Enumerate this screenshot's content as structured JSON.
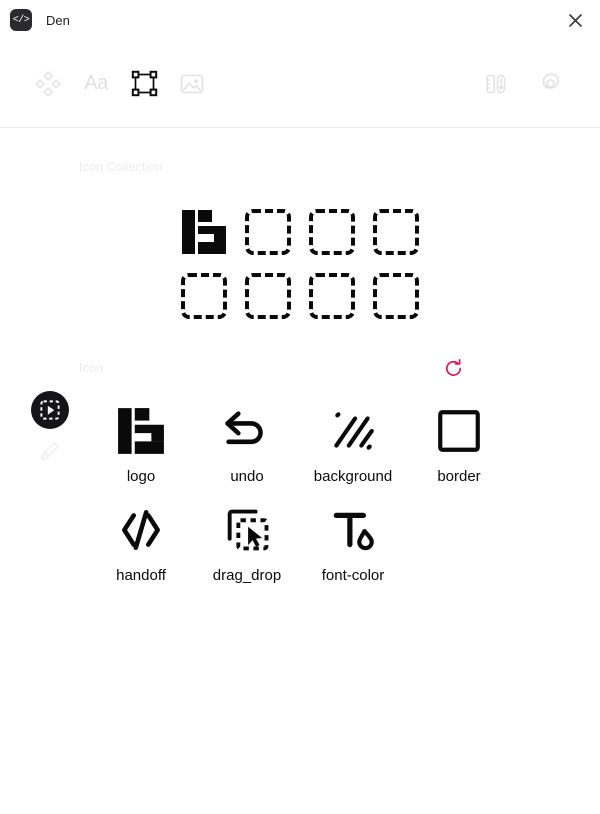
{
  "window": {
    "app_name": "Den",
    "logo_glyph": "</>",
    "logo_icon": "code-brackets-icon",
    "close_icon": "close-icon"
  },
  "toolbar": {
    "left_tools": [
      {
        "name": "shapes-tool",
        "icon": "four-diamonds-icon",
        "label": "",
        "active": false
      },
      {
        "name": "text-tool",
        "icon": "text-aa-icon",
        "label": "Aa",
        "active": false
      },
      {
        "name": "frame-tool",
        "icon": "selection-frame-icon",
        "label": "",
        "active": true
      },
      {
        "name": "image-tool",
        "icon": "image-icon",
        "label": "",
        "active": false
      }
    ],
    "right_tools": [
      {
        "name": "measure-tool",
        "icon": "ruler-icon"
      },
      {
        "name": "settings",
        "icon": "gear-icon"
      }
    ]
  },
  "collection": {
    "label": "Icon Collection",
    "cells": [
      {
        "type": "logo",
        "name": "collection-logo"
      },
      {
        "type": "placeholder",
        "name": "collection-placeholder"
      },
      {
        "type": "placeholder",
        "name": "collection-placeholder"
      },
      {
        "type": "placeholder",
        "name": "collection-placeholder"
      },
      {
        "type": "placeholder",
        "name": "collection-placeholder"
      },
      {
        "type": "placeholder",
        "name": "collection-placeholder"
      },
      {
        "type": "placeholder",
        "name": "collection-placeholder"
      },
      {
        "type": "placeholder",
        "name": "collection-placeholder"
      }
    ]
  },
  "icons_section": {
    "label": "Icon",
    "refresh_icon": "refresh-icon",
    "refresh_color": "#e0115f",
    "items": [
      {
        "label": "logo",
        "icon": "logo-icon"
      },
      {
        "label": "undo",
        "icon": "undo-arrow-icon"
      },
      {
        "label": "background",
        "icon": "diagonal-stripes-icon"
      },
      {
        "label": "border",
        "icon": "square-outline-icon"
      },
      {
        "label": "handoff",
        "icon": "code-slash-icon"
      },
      {
        "label": "drag_drop",
        "icon": "drag-drop-cursor-icon"
      },
      {
        "label": "font-color",
        "icon": "font-color-icon"
      }
    ]
  },
  "floating": {
    "fab": {
      "name": "select-frame-fab",
      "icon": "frame-cursor-icon"
    },
    "brush": {
      "name": "brush-tool-ghost",
      "icon": "paintbrush-icon"
    }
  },
  "colors": {
    "accent": "#e0115f",
    "ink": "#0a0a0a",
    "muted": "#ececee",
    "fab_bg": "#151517"
  }
}
